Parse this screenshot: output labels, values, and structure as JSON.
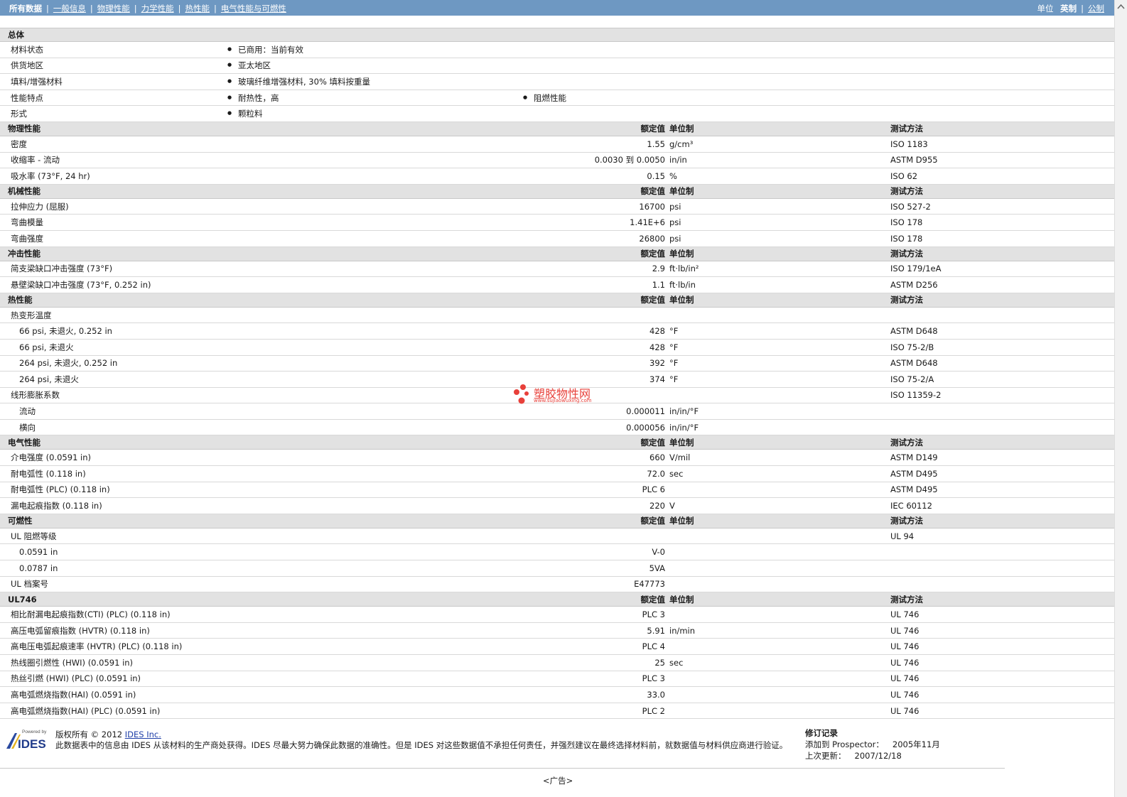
{
  "nav": {
    "items": [
      "所有数据",
      "一般信息",
      "物理性能",
      "力学性能",
      "热性能",
      "电气性能与可燃性"
    ],
    "units_label": "单位",
    "unit_active": "英制",
    "unit_other": "公制"
  },
  "general": {
    "title": "总体",
    "rows": [
      {
        "label": "材料状态",
        "b1": "已商用：当前有效",
        "b2": ""
      },
      {
        "label": "供货地区",
        "b1": "亚太地区",
        "b2": ""
      },
      {
        "label": "填料/增强材料",
        "b1": "玻璃纤维增强材料, 30% 填料按重量",
        "b2": ""
      },
      {
        "label": "性能特点",
        "b1": "耐热性，高",
        "b2": "阻燃性能"
      },
      {
        "label": "形式",
        "b1": "颗粒料",
        "b2": ""
      }
    ]
  },
  "headers": {
    "value": "额定值",
    "unit": "单位制",
    "method": "测试方法"
  },
  "sections": [
    {
      "title": "物理性能",
      "rows": [
        {
          "label": "密度",
          "sub": false,
          "value": "1.55",
          "unit": "g/cm³",
          "method": "ISO 1183"
        },
        {
          "label": "收缩率 - 流动",
          "sub": false,
          "value": "0.0030 到  0.0050",
          "unit": "in/in",
          "method": "ASTM D955"
        },
        {
          "label": "吸水率 (73°F, 24 hr)",
          "sub": false,
          "value": "0.15",
          "unit": "%",
          "method": "ISO 62"
        }
      ]
    },
    {
      "title": "机械性能",
      "rows": [
        {
          "label": "拉伸应力 (屈服)",
          "sub": false,
          "value": "16700",
          "unit": "psi",
          "method": "ISO 527-2"
        },
        {
          "label": "弯曲模量",
          "sub": false,
          "value": "1.41E+6",
          "unit": "psi",
          "method": "ISO 178"
        },
        {
          "label": "弯曲强度",
          "sub": false,
          "value": "26800",
          "unit": "psi",
          "method": "ISO 178"
        }
      ]
    },
    {
      "title": "冲击性能",
      "rows": [
        {
          "label": "简支梁缺口冲击强度 (73°F)",
          "sub": false,
          "value": "2.9",
          "unit": "ft·lb/in²",
          "method": "ISO 179/1eA"
        },
        {
          "label": "悬壁梁缺口冲击强度 (73°F, 0.252 in)",
          "sub": false,
          "value": "1.1",
          "unit": "ft·lb/in",
          "method": "ASTM D256"
        }
      ]
    },
    {
      "title": "热性能",
      "rows": [
        {
          "label": "热变形温度",
          "sub": false,
          "value": "",
          "unit": "",
          "method": ""
        },
        {
          "label": "66 psi, 未退火, 0.252 in",
          "sub": true,
          "value": "428",
          "unit": "°F",
          "method": "ASTM D648"
        },
        {
          "label": "66 psi, 未退火",
          "sub": true,
          "value": "428",
          "unit": "°F",
          "method": "ISO 75-2/B"
        },
        {
          "label": "264 psi, 未退火, 0.252 in",
          "sub": true,
          "value": "392",
          "unit": "°F",
          "method": "ASTM D648"
        },
        {
          "label": "264 psi, 未退火",
          "sub": true,
          "value": "374",
          "unit": "°F",
          "method": "ISO 75-2/A"
        },
        {
          "label": "线形膨胀系数",
          "sub": false,
          "value": "",
          "unit": "",
          "method": "ISO 11359-2"
        },
        {
          "label": "流动",
          "sub": true,
          "value": "0.000011",
          "unit": "in/in/°F",
          "method": ""
        },
        {
          "label": "横向",
          "sub": true,
          "value": "0.000056",
          "unit": "in/in/°F",
          "method": ""
        }
      ]
    },
    {
      "title": "电气性能",
      "rows": [
        {
          "label": "介电强度 (0.0591 in)",
          "sub": false,
          "value": "660",
          "unit": "V/mil",
          "method": "ASTM D149"
        },
        {
          "label": "耐电弧性 (0.118 in)",
          "sub": false,
          "value": "72.0",
          "unit": "sec",
          "method": "ASTM D495"
        },
        {
          "label": "耐电弧性 (PLC) (0.118 in)",
          "sub": false,
          "value": "PLC 6",
          "unit": "",
          "method": "ASTM D495"
        },
        {
          "label": "漏电起痕指数 (0.118 in)",
          "sub": false,
          "value": "220",
          "unit": "V",
          "method": "IEC 60112"
        }
      ]
    },
    {
      "title": "可燃性",
      "rows": [
        {
          "label": "UL 阻燃等级",
          "sub": false,
          "value": "",
          "unit": "",
          "method": "UL 94"
        },
        {
          "label": "0.0591 in",
          "sub": true,
          "value": "V-0",
          "unit": "",
          "method": ""
        },
        {
          "label": "0.0787 in",
          "sub": true,
          "value": "5VA",
          "unit": "",
          "method": ""
        },
        {
          "label": "UL 档案号",
          "sub": false,
          "value": "E47773",
          "unit": "",
          "method": ""
        }
      ]
    },
    {
      "title": "UL746",
      "rows": [
        {
          "label": "相比耐漏电起痕指数(CTI) (PLC) (0.118 in)",
          "sub": false,
          "value": "PLC 3",
          "unit": "",
          "method": "UL 746"
        },
        {
          "label": "高压电弧留痕指数 (HVTR) (0.118 in)",
          "sub": false,
          "value": "5.91",
          "unit": "in/min",
          "method": "UL 746"
        },
        {
          "label": "高电压电弧起痕速率 (HVTR) (PLC) (0.118 in)",
          "sub": false,
          "value": "PLC 4",
          "unit": "",
          "method": "UL 746"
        },
        {
          "label": "热线圈引燃性 (HWI) (0.0591 in)",
          "sub": false,
          "value": "25",
          "unit": "sec",
          "method": "UL 746"
        },
        {
          "label": "热丝引燃 (HWI) (PLC) (0.0591 in)",
          "sub": false,
          "value": "PLC 3",
          "unit": "",
          "method": "UL 746"
        },
        {
          "label": "高电弧燃烧指数(HAI) (0.0591 in)",
          "sub": false,
          "value": "33.0",
          "unit": "",
          "method": "UL 746"
        },
        {
          "label": "高电弧燃烧指数(HAI) (PLC) (0.0591 in)",
          "sub": false,
          "value": "PLC 2",
          "unit": "",
          "method": "UL 746"
        }
      ]
    }
  ],
  "watermark": {
    "text": "塑胶物性网",
    "url": "www.sujiaowuxing.com"
  },
  "footer": {
    "logo_small": "Powered by",
    "logo_big": "IDES",
    "copyright": "版权所有 © 2012",
    "company_link": "IDES Inc.",
    "disclaimer": "此数据表中的信息由 IDES 从该材料的生产商处获得。IDES 尽最大努力确保此数据的准确性。但是 IDES 对这些数据值不承担任何责任，并强烈建议在最终选择材料前，就数据值与材料供应商进行验证。",
    "rev_title": "修订记录",
    "added_label": "添加到 Prospector：",
    "added_date": "2005年11月",
    "updated_label": "上次更新：",
    "updated_date": "2007/12/18",
    "ad": "<广告>"
  }
}
